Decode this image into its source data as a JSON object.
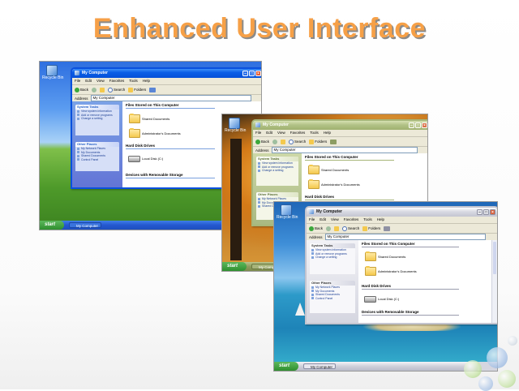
{
  "slide": {
    "title": "Enhanced User Interface"
  },
  "screenshots": [
    {
      "theme": "blue",
      "window_title": "My Computer",
      "menu": [
        "File",
        "Edit",
        "View",
        "Favorites",
        "Tools",
        "Help"
      ],
      "toolbar": {
        "back": "Back",
        "search": "Search",
        "folders": "Folders"
      },
      "address": {
        "label": "Address",
        "value": "My Computer"
      },
      "taskpane": [
        {
          "title": "System Tasks",
          "items": [
            "View system information",
            "Add or remove programs",
            "Change a setting"
          ]
        },
        {
          "title": "Other Places",
          "items": [
            "My Network Places",
            "My Documents",
            "Shared Documents",
            "Control Panel"
          ]
        }
      ],
      "groups": {
        "stored": "Files Stored on This Computer",
        "hdd": "Hard Disk Drives",
        "removable": "Devices with Removable Storage"
      },
      "folders": [
        "Shared Documents",
        "Administrator's Documents"
      ],
      "drive": "Local Disk (C:)",
      "desktop_icon": "Recycle Bin",
      "start_label": "start",
      "task_label": "My Computer",
      "colors": {
        "accent": "#0a51de",
        "taskbar": "#2458cf"
      }
    },
    {
      "theme": "olive",
      "window_title": "My Computer",
      "menu": [
        "File",
        "Edit",
        "View",
        "Favorites",
        "Tools",
        "Help"
      ],
      "toolbar": {
        "back": "Back",
        "search": "Search",
        "folders": "Folders"
      },
      "address": {
        "label": "Address",
        "value": "My Computer"
      },
      "taskpane": [
        {
          "title": "System Tasks",
          "items": [
            "View system information",
            "Add or remove programs",
            "Change a setting"
          ]
        },
        {
          "title": "Other Places",
          "items": [
            "My Network Places",
            "My Documents",
            "Shared Documents"
          ]
        }
      ],
      "groups": {
        "stored": "Files Stored on This Computer",
        "hdd": "Hard Disk Drives"
      },
      "folders": [
        "Shared Documents",
        "Administrator's Documents"
      ],
      "desktop_icon": "Recycle Bin",
      "start_label": "start",
      "task_label": "My Computer",
      "colors": {
        "accent": "#a7b679",
        "taskbar": "#8e9c5d"
      }
    },
    {
      "theme": "silver",
      "window_title": "My Computer",
      "menu": [
        "File",
        "Edit",
        "View",
        "Favorites",
        "Tools",
        "Help"
      ],
      "toolbar": {
        "back": "Back",
        "search": "Search",
        "folders": "Folders"
      },
      "address": {
        "label": "Address",
        "value": "My Computer"
      },
      "taskpane": [
        {
          "title": "System Tasks",
          "items": [
            "View system information",
            "Add or remove programs",
            "Change a setting"
          ]
        },
        {
          "title": "Other Places",
          "items": [
            "My Network Places",
            "My Documents",
            "Shared Documents",
            "Control Panel"
          ]
        }
      ],
      "groups": {
        "stored": "Files Stored on This Computer",
        "hdd": "Hard Disk Drives",
        "removable": "Devices with Removable Storage"
      },
      "folders": [
        "Shared Documents",
        "Administrator's Documents"
      ],
      "drive": "Local Disk (C:)",
      "desktop_icon": "Recycle Bin",
      "start_label": "start",
      "task_label": "My Computer",
      "colors": {
        "accent": "#c3c4cf",
        "taskbar": "#cfd0da"
      }
    }
  ]
}
